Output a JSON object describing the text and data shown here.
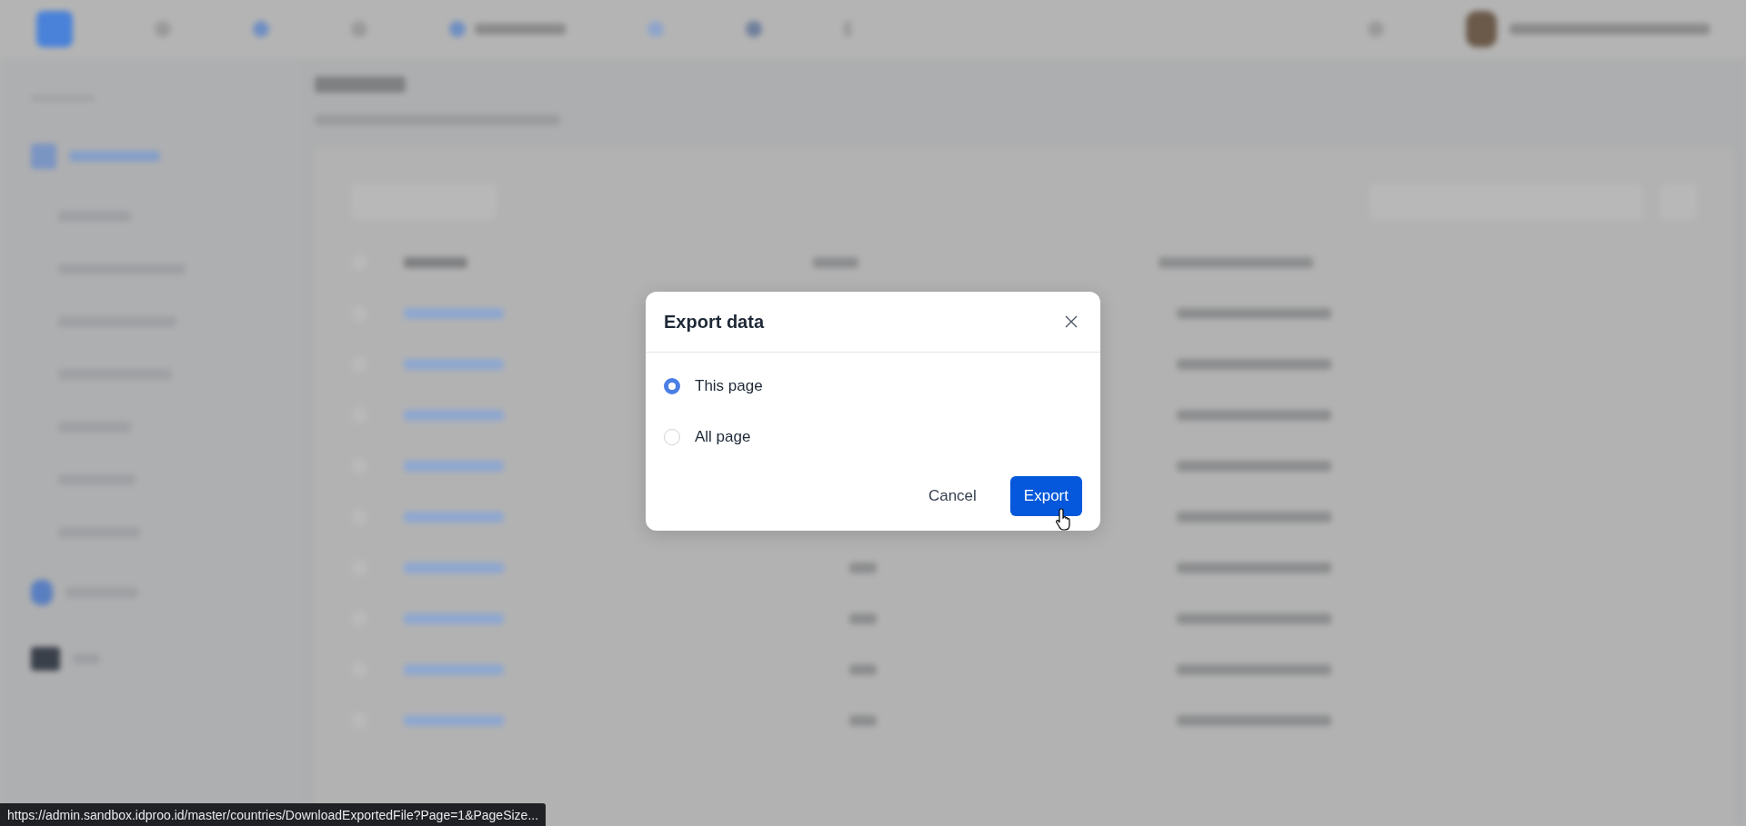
{
  "dialog": {
    "title": "Export data",
    "options": [
      {
        "label": "This page",
        "selected": true
      },
      {
        "label": "All page",
        "selected": false
      }
    ],
    "buttons": [
      {
        "label": "Cancel",
        "kind": "secondary"
      },
      {
        "label": "Export",
        "kind": "primary"
      }
    ]
  },
  "status_url": "https://admin.sandbox.idproo.id/master/countries/DownloadExportedFile?Page=1&PageSize..."
}
